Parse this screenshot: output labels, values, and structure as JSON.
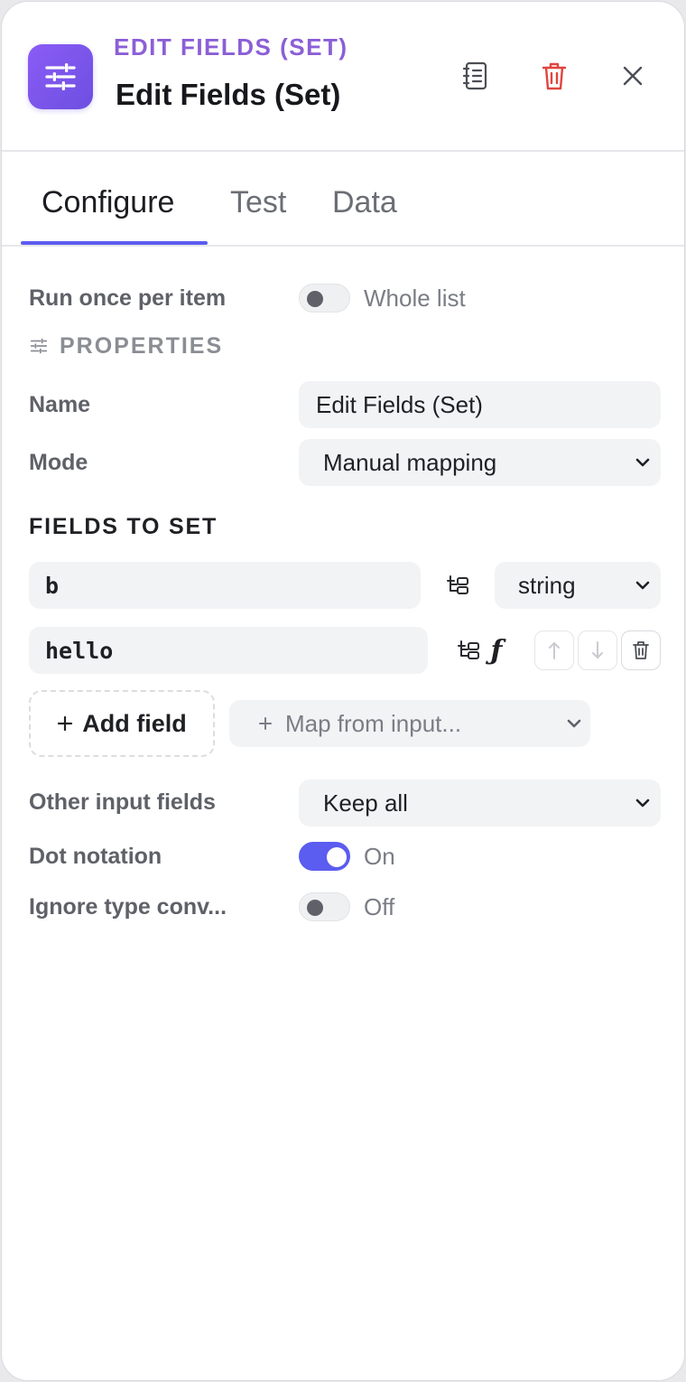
{
  "header": {
    "eyebrow": "EDIT FIELDS (SET)",
    "title": "Edit Fields (Set)",
    "icons": {
      "node": "sliders-icon",
      "docs": "docs-icon",
      "delete": "trash-icon",
      "close": "close-icon"
    },
    "colors": {
      "accent": "#8b5fd6",
      "delete": "#e0443e"
    }
  },
  "tabs": [
    {
      "label": "Configure",
      "active": true
    },
    {
      "label": "Test",
      "active": false
    },
    {
      "label": "Data",
      "active": false
    }
  ],
  "run_mode": {
    "label": "Run once per item",
    "toggle_text": "Whole list",
    "on": false
  },
  "properties": {
    "section_label": "PROPERTIES",
    "name_label": "Name",
    "name_value": "Edit Fields (Set)",
    "mode_label": "Mode",
    "mode_value": "Manual mapping"
  },
  "fields_to_set": {
    "title": "FIELDS TO SET",
    "rows": [
      {
        "name": "b",
        "type": "string"
      },
      {
        "value": "hello",
        "expression_symbol": "ƒ"
      }
    ],
    "add_field_label": "Add field",
    "map_from_input_placeholder": "Map from input..."
  },
  "options": {
    "other_input_fields_label": "Other input fields",
    "other_input_fields_value": "Keep all",
    "dot_notation_label": "Dot notation",
    "dot_notation_state": "On",
    "dot_notation_on": true,
    "ignore_type_label": "Ignore type conv...",
    "ignore_type_state": "Off",
    "ignore_type_on": false
  },
  "colors": {
    "toggle_on": "#5b5cf0",
    "tab_underline": "#5b5cf0"
  }
}
